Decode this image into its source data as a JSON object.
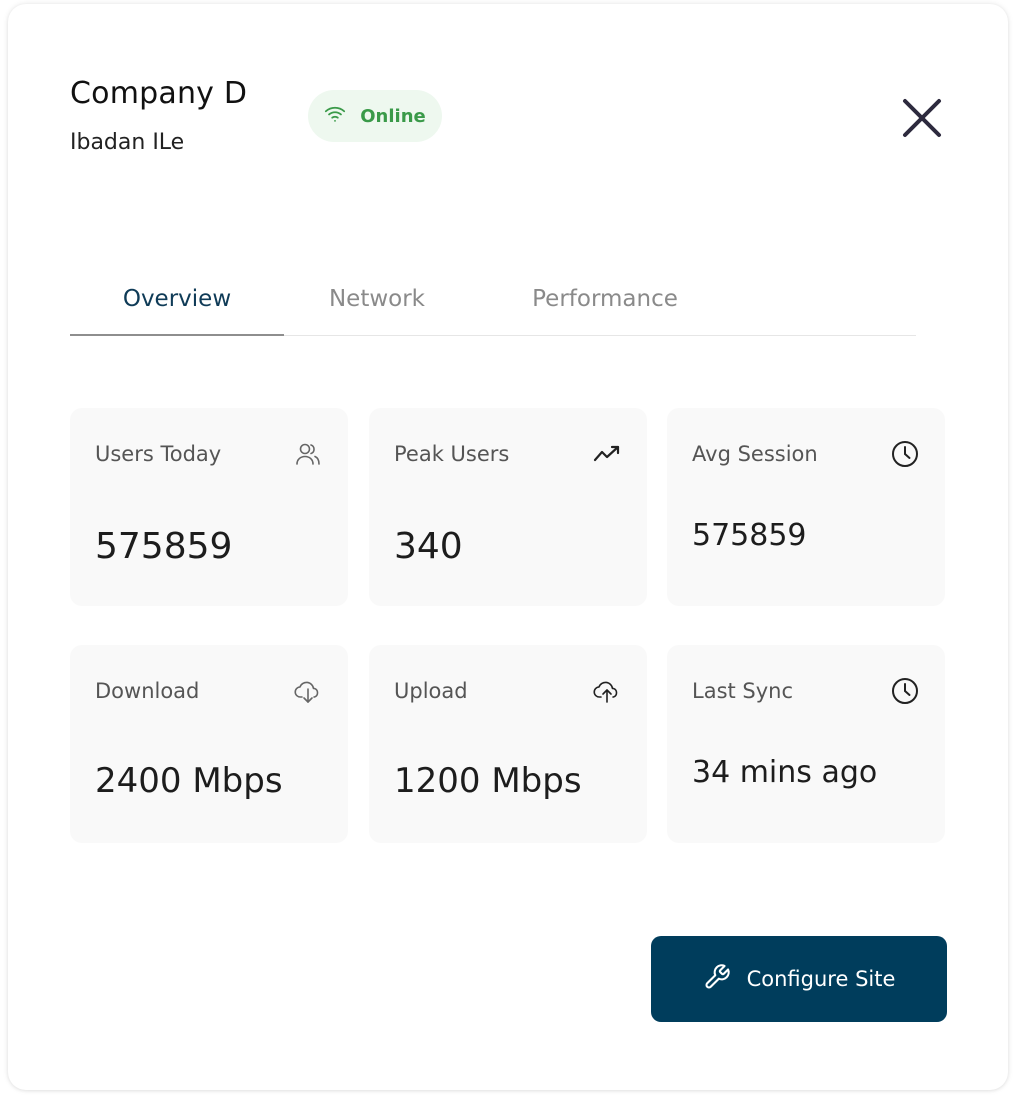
{
  "header": {
    "title": "Company D",
    "subtitle": "Ibadan ILe",
    "status_label": "Online",
    "status_color": "#3a9a49"
  },
  "tabs": [
    {
      "label": "Overview",
      "active": true
    },
    {
      "label": "Network",
      "active": false
    },
    {
      "label": "Performance",
      "active": false
    }
  ],
  "stats": [
    {
      "label": "Users Today",
      "value": "575859",
      "icon": "users-icon"
    },
    {
      "label": "Peak Users",
      "value": "340",
      "icon": "trending-icon"
    },
    {
      "label": "Avg Session",
      "value": "575859",
      "icon": "clock-icon"
    },
    {
      "label": "Download",
      "value": "2400 Mbps",
      "icon": "download-cloud-icon"
    },
    {
      "label": "Upload",
      "value": "1200 Mbps",
      "icon": "upload-cloud-icon"
    },
    {
      "label": "Last Sync",
      "value": "34 mins ago",
      "icon": "clock-icon"
    }
  ],
  "actions": {
    "configure_label": "Configure Site",
    "configure_icon": "wrench-icon",
    "primary_color": "#003d5c"
  }
}
